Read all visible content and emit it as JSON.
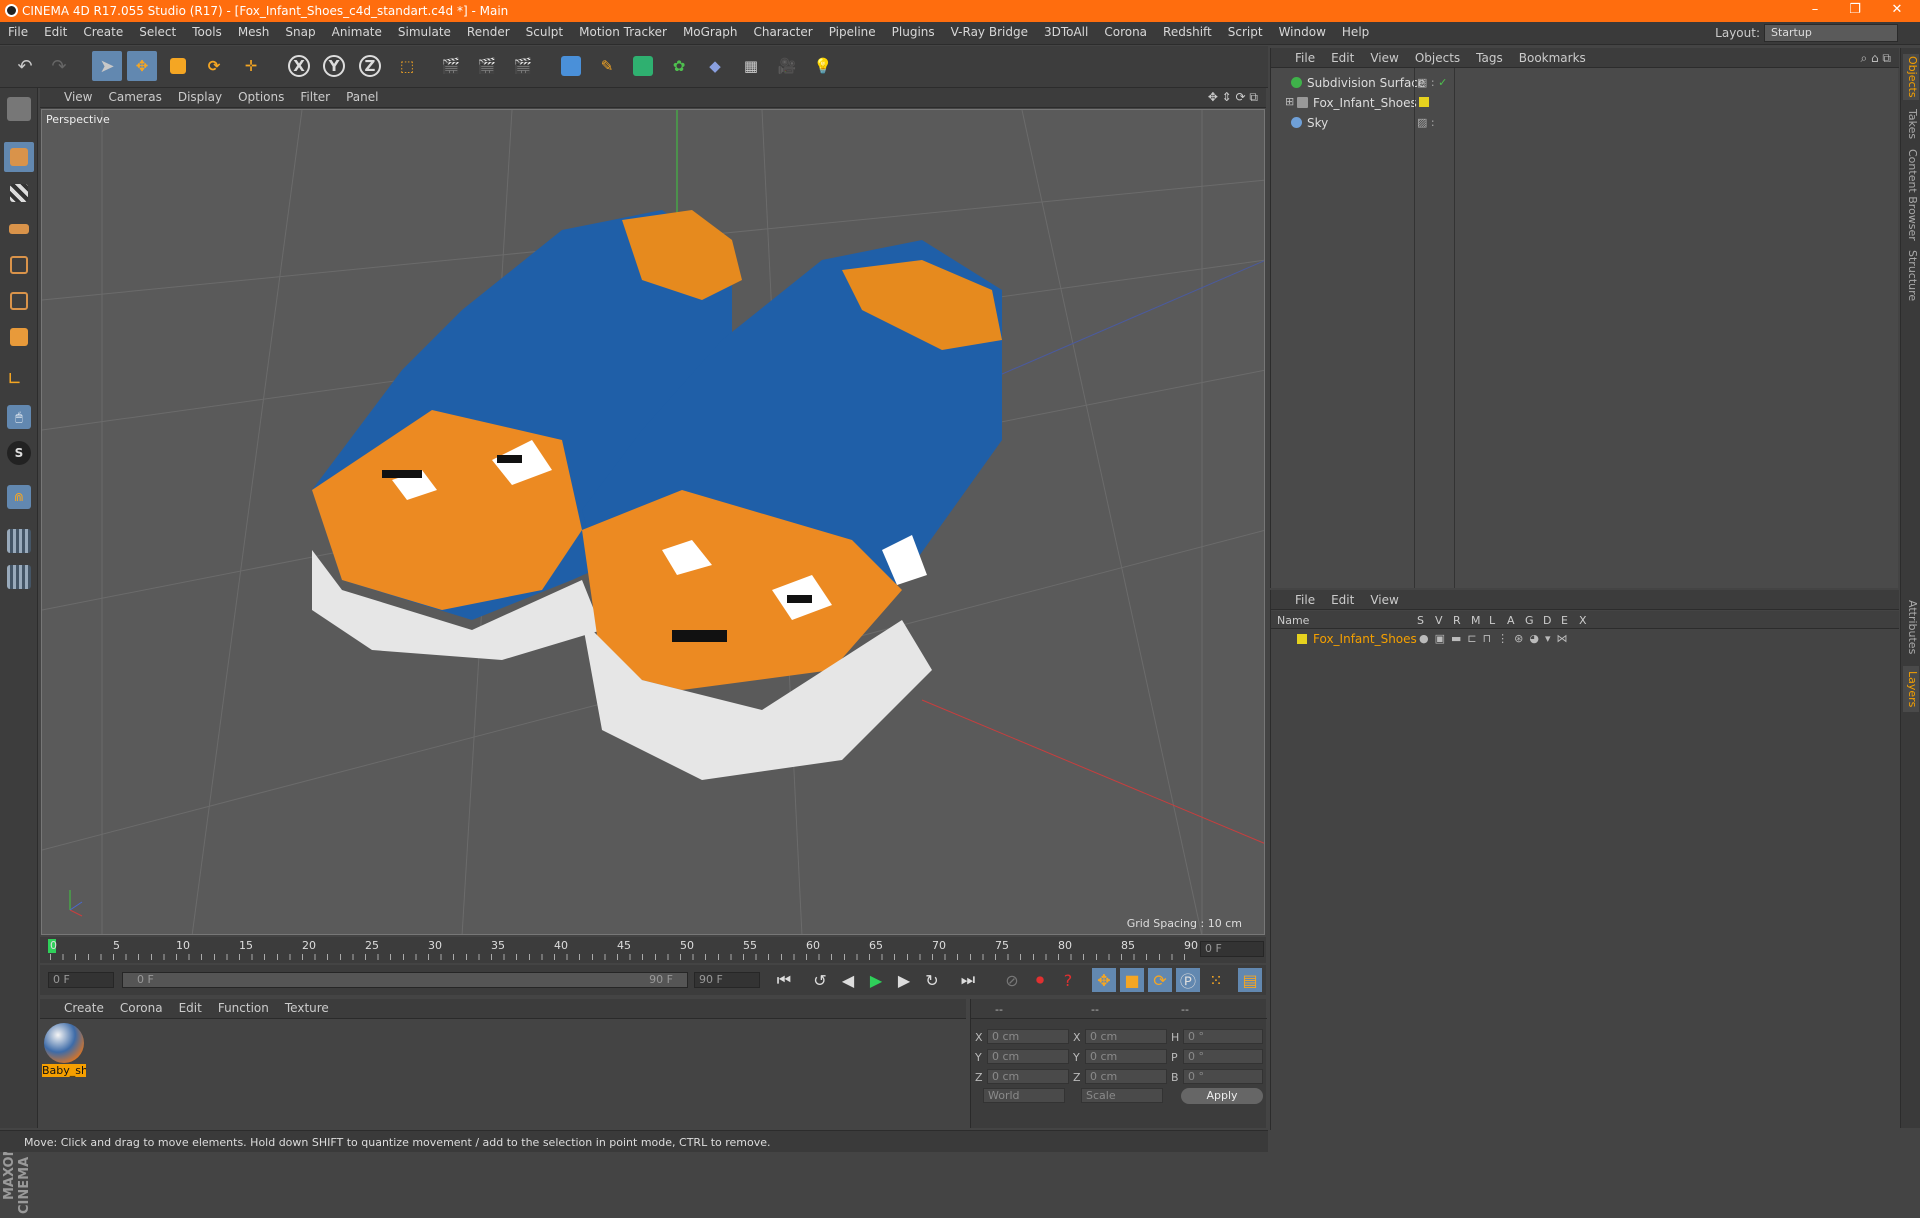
{
  "title_bar": {
    "text": "CINEMA 4D R17.055 Studio (R17) - [Fox_Infant_Shoes_c4d_standart.c4d *] - Main"
  },
  "menu": [
    "File",
    "Edit",
    "Create",
    "Select",
    "Tools",
    "Mesh",
    "Snap",
    "Animate",
    "Simulate",
    "Render",
    "Sculpt",
    "Motion Tracker",
    "MoGraph",
    "Character",
    "Pipeline",
    "Plugins",
    "V-Ray Bridge",
    "3DToAll",
    "Corona",
    "Redshift",
    "Script",
    "Window",
    "Help"
  ],
  "layout": {
    "label": "Layout:",
    "value": "Startup"
  },
  "viewport": {
    "menu": [
      "View",
      "Cameras",
      "Display",
      "Options",
      "Filter",
      "Panel"
    ],
    "camera_label": "Perspective",
    "grid_spacing": "Grid Spacing : 10 cm"
  },
  "timeline": {
    "ticks": [
      "0",
      "5",
      "10",
      "15",
      "20",
      "25",
      "30",
      "35",
      "40",
      "45",
      "50",
      "55",
      "60",
      "65",
      "70",
      "75",
      "80",
      "85",
      "90"
    ],
    "current_frame_field": "0 F",
    "start_field": "0 F",
    "range_start": "0 F",
    "range_end": "90 F",
    "end_field": "90 F"
  },
  "material_manager": {
    "menu": [
      "Create",
      "Corona",
      "Edit",
      "Function",
      "Texture"
    ],
    "materials": [
      {
        "label": "Baby_sh"
      }
    ]
  },
  "coordinates": {
    "header": [
      "--",
      "--",
      "--"
    ],
    "rows": [
      {
        "a": "X",
        "v1": "0 cm",
        "b": "X",
        "v2": "0 cm",
        "c": "H",
        "v3": "0 °"
      },
      {
        "a": "Y",
        "v1": "0 cm",
        "b": "Y",
        "v2": "0 cm",
        "c": "P",
        "v3": "0 °"
      },
      {
        "a": "Z",
        "v1": "0 cm",
        "b": "Z",
        "v2": "0 cm",
        "c": "B",
        "v3": "0 °"
      }
    ],
    "mode1": "World",
    "mode2": "Scale",
    "apply": "Apply"
  },
  "object_manager": {
    "menu": [
      "File",
      "Edit",
      "View",
      "Objects",
      "Tags",
      "Bookmarks"
    ],
    "objects": [
      {
        "name": "Subdivision Surface",
        "color": "#3fb24a"
      },
      {
        "name": "Fox_Infant_Shoes",
        "color": "#c8c8c8"
      },
      {
        "name": "Sky",
        "color": "#6fa0d8"
      }
    ]
  },
  "layer_manager": {
    "menu": [
      "File",
      "Edit",
      "View"
    ],
    "columns": [
      "Name",
      "S",
      "V",
      "R",
      "M",
      "L",
      "A",
      "G",
      "D",
      "E",
      "X"
    ],
    "layers": [
      {
        "name": "Fox_Infant_Shoes",
        "color": "#e6d21e"
      }
    ]
  },
  "right_tabs": [
    "Objects",
    "Takes",
    "Content Browser",
    "Structure",
    "Attributes",
    "Layers"
  ],
  "status": "Move: Click and drag to move elements. Hold down SHIFT to quantize movement / add to the selection in point mode, CTRL to remove.",
  "brand": "MAXON CINEMA 4D"
}
